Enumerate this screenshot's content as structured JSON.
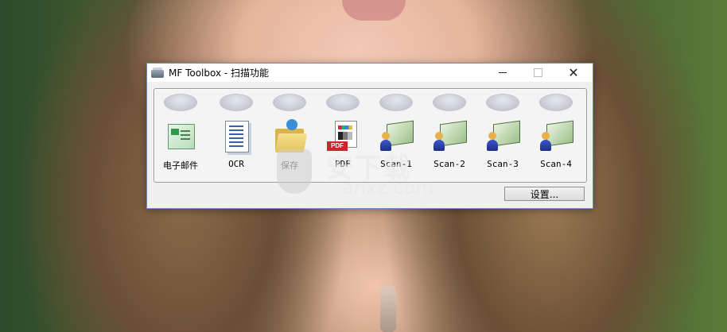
{
  "window": {
    "title": "MF Toolbox - 扫描功能",
    "controls": {
      "minimize": "minimize",
      "maximize": "maximize",
      "close": "✕"
    }
  },
  "toolbar": {
    "items": [
      {
        "label": "电子邮件",
        "icon": "email-icon"
      },
      {
        "label": "OCR",
        "icon": "ocr-document-icon"
      },
      {
        "label": "保存",
        "icon": "folder-save-icon",
        "dim": true
      },
      {
        "label": "PDF",
        "icon": "pdf-icon"
      },
      {
        "label": "Scan-1",
        "icon": "scan-user-icon"
      },
      {
        "label": "Scan-2",
        "icon": "scan-user-icon"
      },
      {
        "label": "Scan-3",
        "icon": "scan-user-icon"
      },
      {
        "label": "Scan-4",
        "icon": "scan-user-icon"
      }
    ]
  },
  "settings_button": {
    "label": "设置..."
  },
  "watermark": {
    "big": "安下载",
    "small": "anxz.com"
  }
}
